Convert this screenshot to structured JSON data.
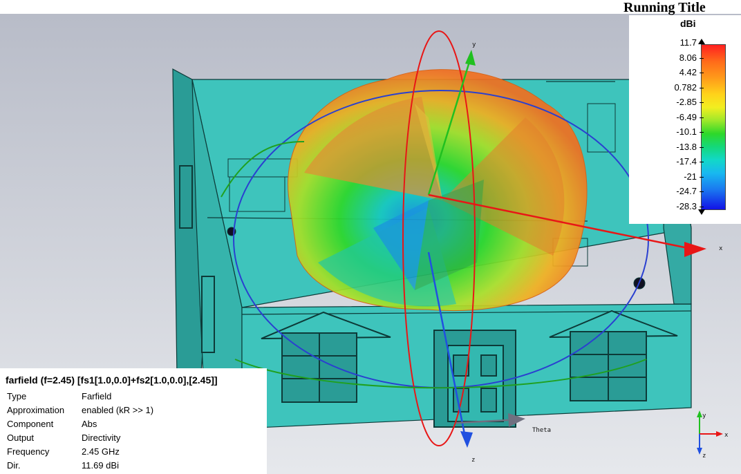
{
  "header": {
    "running_title": "Running Title"
  },
  "legend": {
    "unit": "dBi",
    "ticks": [
      "11.7",
      "8.06",
      "4.42",
      "0.782",
      "-2.85",
      "-6.49",
      "-10.1",
      "-13.8",
      "-17.4",
      "-21",
      "-24.7",
      "-28.3"
    ],
    "max_color": "#ff2020",
    "min_color": "#1212e6"
  },
  "viewport": {
    "axis_labels": {
      "x": "x",
      "y": "y",
      "z": "z",
      "theta": "Theta"
    },
    "scene": "building-with-farfield-pattern",
    "colors": {
      "wall": "#33b8b0",
      "x_axis": "#e81616",
      "y_axis": "#20c020",
      "z_axis": "#2060e0"
    }
  },
  "info": {
    "title": "farfield (f=2.45) [fs1[1.0,0.0]+fs2[1.0,0.0],[2.45]]",
    "rows": [
      {
        "label": "Type",
        "value": "Farfield"
      },
      {
        "label": "Approximation",
        "value": "enabled (kR >> 1)"
      },
      {
        "label": "Component",
        "value": "Abs"
      },
      {
        "label": "Output",
        "value": "Directivity"
      },
      {
        "label": "Frequency",
        "value": "2.45 GHz"
      },
      {
        "label": "Dir.",
        "value": "11.69 dBi"
      }
    ]
  }
}
